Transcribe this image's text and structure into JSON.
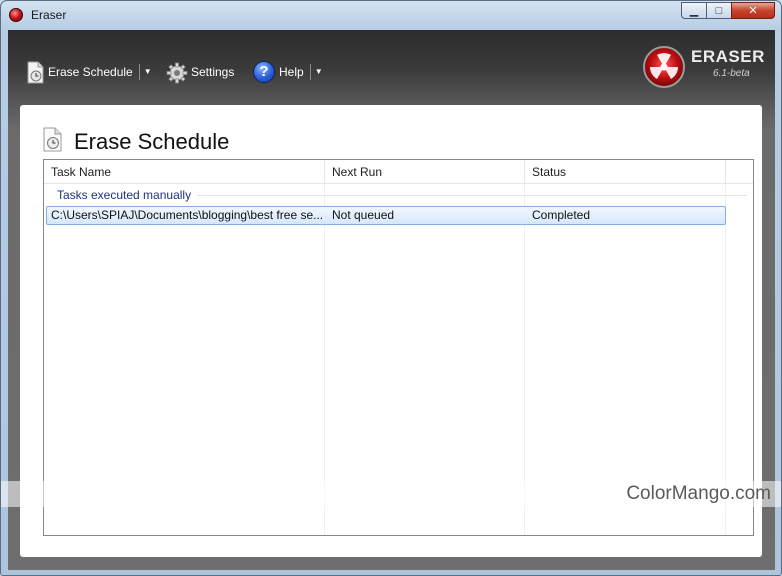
{
  "window": {
    "title": "Eraser",
    "controls": {
      "minimize": "▁",
      "maximize": "□",
      "close": "✕"
    }
  },
  "toolbar": {
    "erase_schedule": {
      "label": "Erase Schedule",
      "icon": "schedule-document-icon"
    },
    "settings": {
      "label": "Settings",
      "icon": "gear-icon"
    },
    "help": {
      "label": "Help",
      "icon": "help-icon",
      "glyph": "?"
    },
    "dropdown_glyph": "▼"
  },
  "logo": {
    "name": "ERASER",
    "version": "6.1-beta"
  },
  "panel": {
    "title": "Erase Schedule"
  },
  "table": {
    "columns": [
      "Task Name",
      "Next Run",
      "Status"
    ],
    "group": "Tasks executed manually",
    "rows": [
      {
        "task": "C:\\Users\\SPIAJ\\Documents\\blogging\\best free se...",
        "next_run": "Not queued",
        "status": "Completed",
        "selected": true
      }
    ]
  },
  "watermark": {
    "text": "ColorMango.com"
  },
  "colors": {
    "accent_red": "#c10e14",
    "selection": "#d6e7fb",
    "group_text": "#1e3287"
  }
}
